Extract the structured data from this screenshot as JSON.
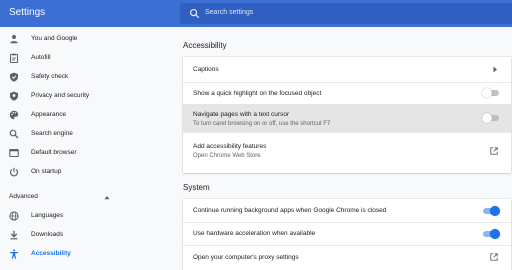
{
  "header": {
    "title": "Settings",
    "search_placeholder": "Search settings"
  },
  "sidebar": {
    "items": [
      {
        "label": "You and Google",
        "icon": "person-icon"
      },
      {
        "label": "Autofill",
        "icon": "clipboard-icon"
      },
      {
        "label": "Safety check",
        "icon": "shield-icon"
      },
      {
        "label": "Privacy and security",
        "icon": "shield-lock-icon"
      },
      {
        "label": "Appearance",
        "icon": "palette-icon"
      },
      {
        "label": "Search engine",
        "icon": "search-icon"
      },
      {
        "label": "Default browser",
        "icon": "browser-icon"
      },
      {
        "label": "On startup",
        "icon": "power-icon"
      }
    ],
    "advanced_label": "Advanced",
    "advanced_items": [
      {
        "label": "Languages",
        "icon": "globe-icon"
      },
      {
        "label": "Downloads",
        "icon": "download-icon"
      },
      {
        "label": "Accessibility",
        "icon": "accessibility-icon",
        "active": true
      }
    ]
  },
  "accessibility": {
    "title": "Accessibility",
    "captions_label": "Captions",
    "highlight_label": "Show a quick highlight on the focused object",
    "highlight_enabled": false,
    "caret_label": "Navigate pages with a text cursor",
    "caret_sub": "To turn caret browsing on or off, use the shortcut F7",
    "caret_enabled": false,
    "features_label": "Add accessibility features",
    "features_sub": "Open Chrome Web Store"
  },
  "system": {
    "title": "System",
    "background_label": "Continue running background apps when Google Chrome is closed",
    "background_enabled": true,
    "hw_label": "Use hardware acceleration when available",
    "hw_enabled": true,
    "proxy_label": "Open your computer's proxy settings"
  },
  "colors": {
    "header_blue": "#3b6fd4",
    "accent": "#1a73e8",
    "icon_gray": "#5f6368"
  }
}
